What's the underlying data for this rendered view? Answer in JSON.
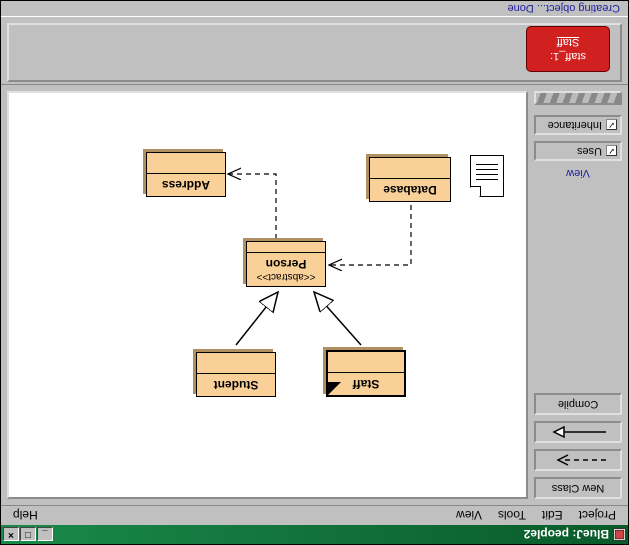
{
  "window": {
    "title": "BlueJ:  people2"
  },
  "menubar": {
    "project": "Project",
    "edit": "Edit",
    "tools": "Tools",
    "view": "View",
    "help": "Help"
  },
  "sidebar": {
    "new_class": "New Class",
    "compile": "Compile",
    "view_label": "View",
    "uses": "Uses",
    "inheritance": "Inheritance"
  },
  "classes": {
    "staff": "Staff",
    "student": "Student",
    "person": "Person",
    "person_stereo": "<<abstract>>",
    "database": "Database",
    "address": "Address"
  },
  "object": {
    "instance": "staff_1:",
    "class": "Staff"
  },
  "status": "Creating object... Done",
  "chart_data": {
    "type": "uml-class-diagram",
    "classes": [
      {
        "name": "Staff",
        "abstract": false,
        "selected": true
      },
      {
        "name": "Student",
        "abstract": false
      },
      {
        "name": "Person",
        "abstract": true,
        "stereotype": "<<abstract>>"
      },
      {
        "name": "Database",
        "abstract": false
      },
      {
        "name": "Address",
        "abstract": false
      }
    ],
    "relations": [
      {
        "from": "Staff",
        "to": "Person",
        "type": "inheritance"
      },
      {
        "from": "Student",
        "to": "Person",
        "type": "inheritance"
      },
      {
        "from": "Database",
        "to": "Person",
        "type": "uses"
      },
      {
        "from": "Person",
        "to": "Address",
        "type": "uses"
      }
    ]
  }
}
